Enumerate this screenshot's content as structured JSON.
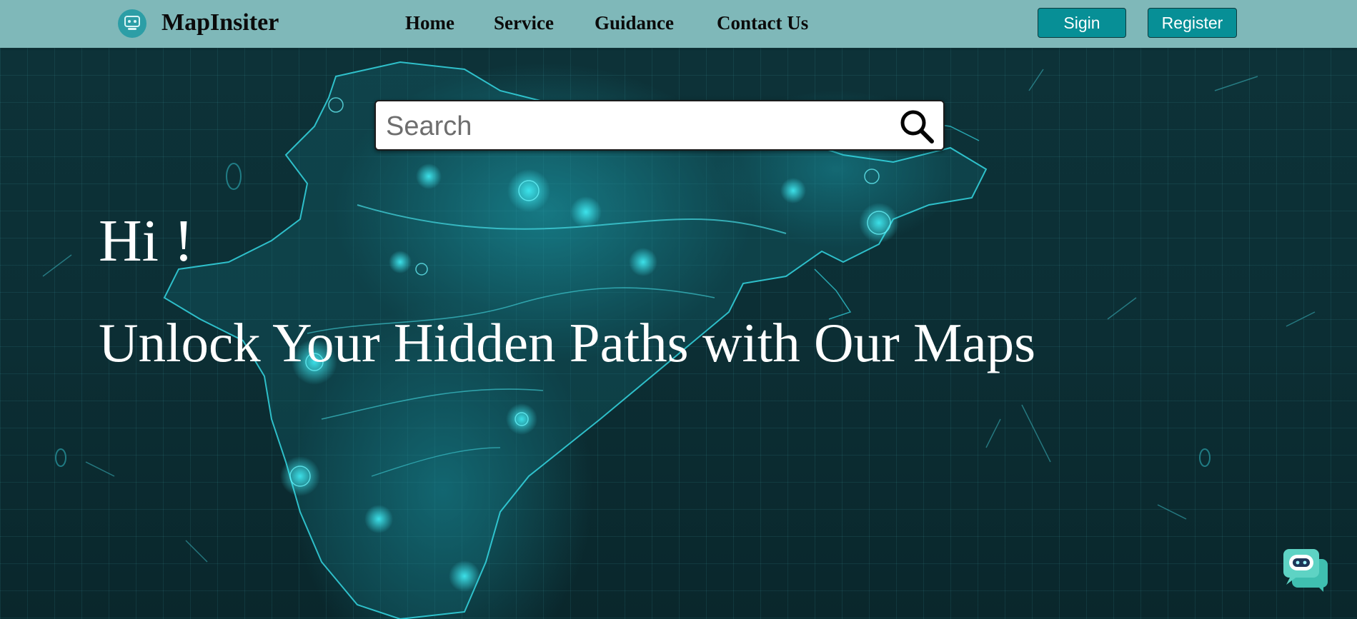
{
  "brand": {
    "name": "MapInsiter",
    "logo_icon": "robot-logo-icon"
  },
  "nav": {
    "links": [
      {
        "label": "Home"
      },
      {
        "label": "Service"
      },
      {
        "label": "Guidance"
      },
      {
        "label": "Contact Us"
      }
    ],
    "signin_label": "Sigin",
    "register_label": "Register"
  },
  "search": {
    "placeholder": "Search",
    "value": "",
    "icon": "search-icon"
  },
  "hero": {
    "greeting": "Hi !",
    "tagline": "Unlock Your Hidden Paths with Our Maps"
  },
  "chat": {
    "icon": "chatbot-icon"
  },
  "colors": {
    "navbar_bg": "#7fb8b9",
    "button_bg": "#078f96",
    "hero_bg": "#0c2f35",
    "map_glow": "#2fe3ee"
  }
}
